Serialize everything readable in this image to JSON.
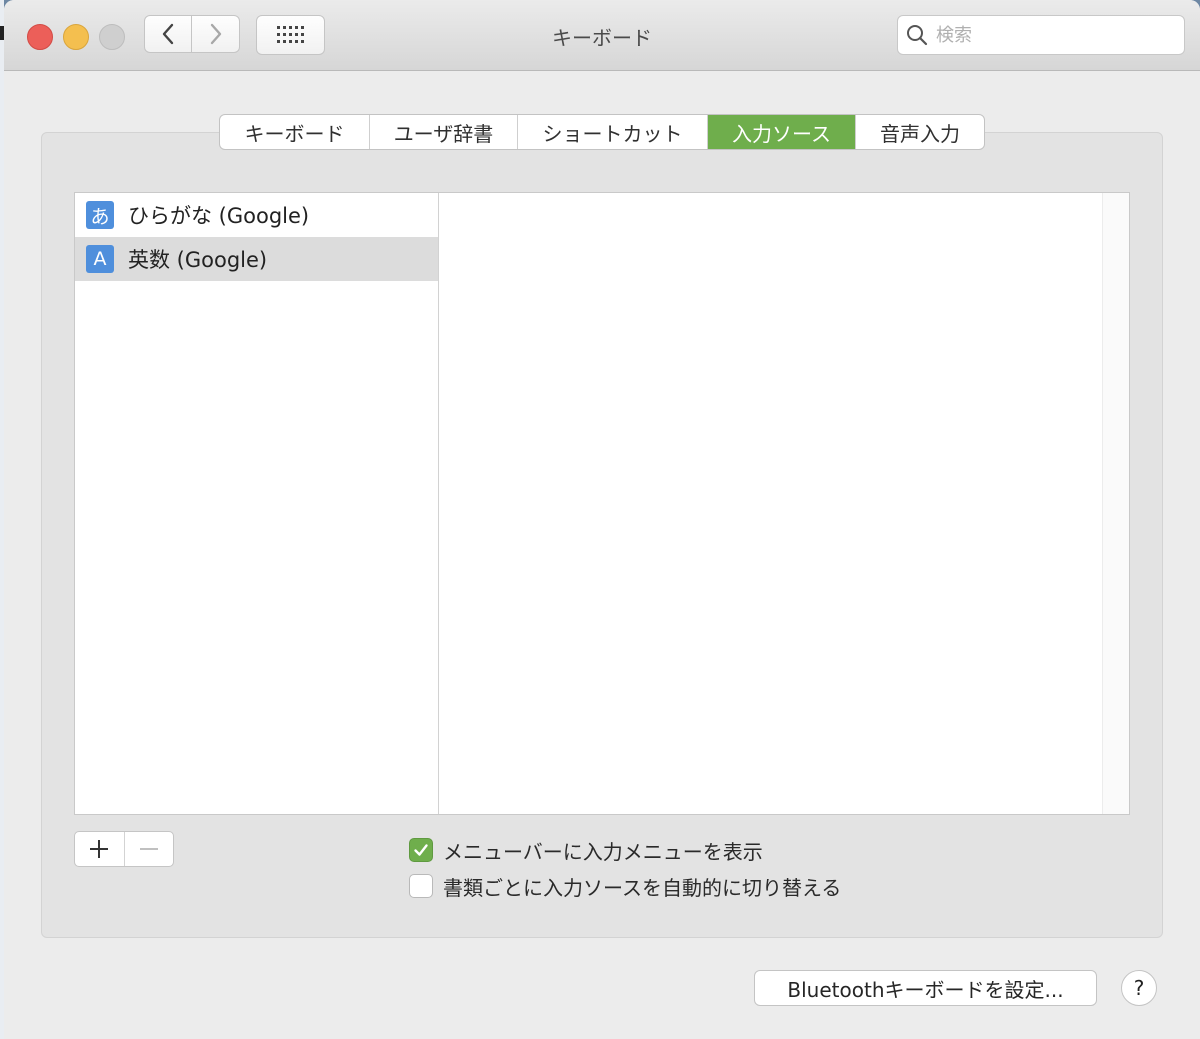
{
  "window": {
    "title": "キーボード",
    "search_placeholder": "検索"
  },
  "toolbar": {
    "back_icon": "chevron-left-icon",
    "forward_icon": "chevron-right-icon",
    "grid_icon": "grid-icon",
    "search_icon": "search-icon"
  },
  "tabs": [
    {
      "label": "キーボード",
      "active": false
    },
    {
      "label": "ユーザ辞書",
      "active": false
    },
    {
      "label": "ショートカット",
      "active": false
    },
    {
      "label": "入力ソース",
      "active": true
    },
    {
      "label": "音声入力",
      "active": false
    }
  ],
  "sources": [
    {
      "icon_text": "あ",
      "label": "ひらがな (Google)",
      "selected": false
    },
    {
      "icon_text": "A",
      "label": "英数 (Google)",
      "selected": true
    }
  ],
  "buttons": {
    "add": "+",
    "remove": "−",
    "bluetooth": "Bluetoothキーボードを設定...",
    "help": "?"
  },
  "options": [
    {
      "label": "メニューバーに入力メニューを表示",
      "checked": true
    },
    {
      "label": "書類ごとに入力ソースを自動的に切り替える",
      "checked": false
    }
  ],
  "colors": {
    "accent_green": "#6fae4c",
    "source_icon_blue": "#4f8fdc",
    "close": "#ec5f59",
    "minimize": "#f4bf4f"
  }
}
